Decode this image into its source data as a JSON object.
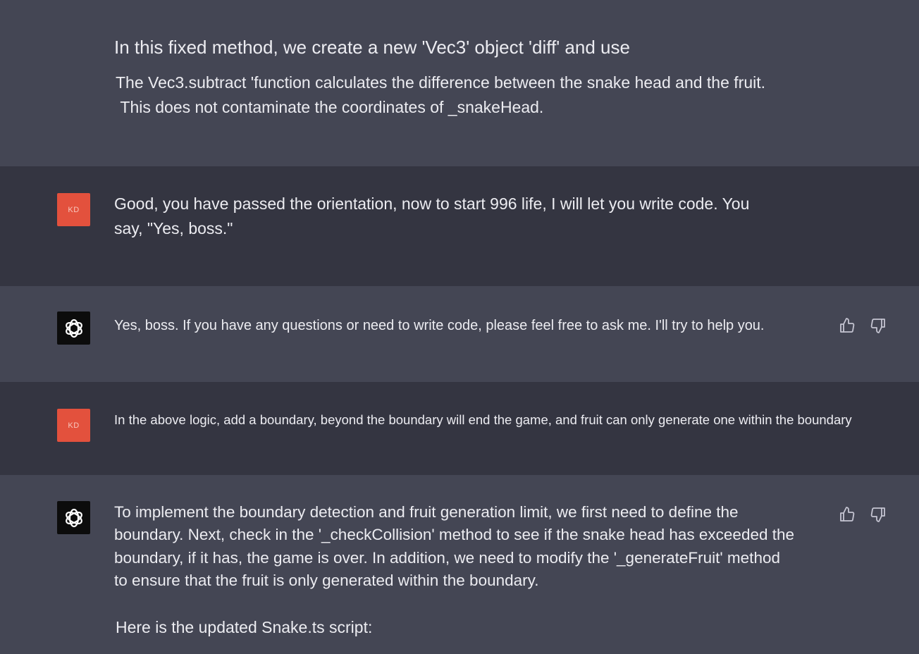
{
  "messages": [
    {
      "role": "assistant",
      "lines": [
        "In this fixed method, we create a new 'Vec3' object 'diff' and use",
        "The Vec3.subtract 'function calculates the difference between the snake head and the fruit.",
        " This does not contaminate the coordinates of _snakeHead."
      ]
    },
    {
      "role": "user",
      "avatar_label": "KD",
      "lines": [
        "Good, you have passed the orientation, now to start 996 life, I will let you write code. You",
        "say, \"Yes, boss.\""
      ]
    },
    {
      "role": "assistant",
      "avatar_icon": "openai-logo-icon",
      "lines": [
        "Yes, boss. If you have any questions or need to write code, please feel free to ask me. I'll try to help you."
      ]
    },
    {
      "role": "user",
      "avatar_label": "KD",
      "lines": [
        "In the above logic, add a boundary, beyond the boundary will end the game, and fruit can only generate one within the boundary"
      ]
    },
    {
      "role": "assistant",
      "avatar_icon": "openai-logo-icon",
      "lines": [
        "To implement the boundary detection and fruit generation limit, we first need to define the",
        "boundary. Next, check in the '_checkCollision' method to see if the snake head has exceeded the",
        "boundary, if it has, the game is over. In addition, we need to modify the '_generateFruit' method",
        "to ensure that the fruit is only generated within the boundary.",
        "Here is the updated Snake.ts script:"
      ]
    }
  ],
  "feedback_icons": [
    "thumbs-up-icon",
    "thumbs-down-icon"
  ],
  "colors": {
    "assistant_bg": "#444654",
    "user_bg": "#343541",
    "user_avatar": "#e3513d",
    "bot_avatar": "#0c0c0c",
    "text": "#ececf1"
  }
}
